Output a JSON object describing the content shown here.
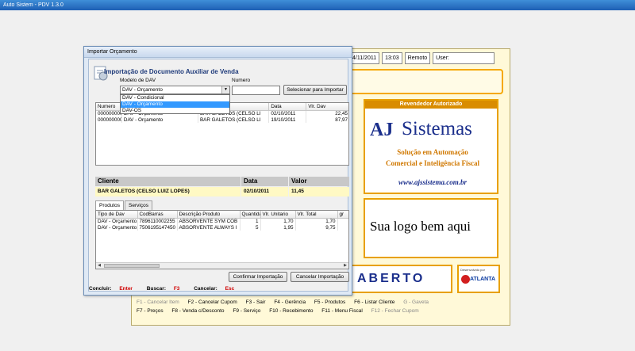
{
  "app": {
    "title": "Auto Sistem - PDV 1.3.0"
  },
  "pdv": {
    "date": "4/11/2011",
    "time": "13:03",
    "mode": "Remoto",
    "user_label": "User:",
    "reseller_header": "Revendedor Autorizado",
    "brand_a": "AJ",
    "brand_name": "Sistemas",
    "slogan_1": "Solução em Automação",
    "slogan_2": "Comercial e Inteligência Fiscal",
    "website": "www.ajssistema.com.br",
    "logo_placeholder": "Sua logo bem aqui",
    "status": "ABERTO",
    "partner_caption": "Desenvolvido por",
    "partner_name": "ATLANTA",
    "shortcuts": [
      {
        "text": "F1 - Cancelar Item",
        "dim": true
      },
      {
        "text": "F2 - Cancelar Cupom",
        "dim": false
      },
      {
        "text": "F3 - Sair",
        "dim": false
      },
      {
        "text": "F4 - Gerência",
        "dim": false
      },
      {
        "text": "F5 - Produtos",
        "dim": false
      },
      {
        "text": "F6 - Listar Cliente",
        "dim": false
      },
      {
        "text": "G - Gaveta",
        "dim": true
      },
      {
        "text": "F7 - Preços",
        "dim": false
      },
      {
        "text": "F8 - Venda c/Desconto",
        "dim": false
      },
      {
        "text": "F9 - Serviço",
        "dim": false
      },
      {
        "text": "F10 - Recebimento",
        "dim": false
      },
      {
        "text": "F11 - Menu Fiscal",
        "dim": false
      },
      {
        "text": "F12 - Fechar Cupom",
        "dim": true
      }
    ]
  },
  "dialog": {
    "title": "Importar Orçamento",
    "heading": "Importação de Documento Auxiliar de Venda",
    "model_label": "Modelo de DAV",
    "number_label": "Numero",
    "selected_model": "DAV - Orçamento",
    "model_options": [
      "DAV - Condicional",
      "DAV - Orçamento",
      "DAV-OS"
    ],
    "number_value": "",
    "select_button": "Selecionar para Importar",
    "dav_columns": [
      "Numero",
      "",
      "dio Cliente",
      "Data",
      "Vlr. Dav"
    ],
    "dav_rows": [
      [
        "0000000002",
        "DAV - Orçamento",
        "BAR GALETOS (CELSO LI",
        "02/10/2011",
        "22,45"
      ],
      [
        "0000000004",
        "DAV - Orçamento",
        "BAR GALETOS (CELSO LI",
        "19/10/2011",
        "87,97"
      ]
    ],
    "summary": {
      "client_label": "Cliente",
      "date_label": "Data",
      "value_label": "Valor",
      "client": "BAR GALETOS (CELSO LUIZ LOPES)",
      "date": "02/10/2011",
      "value": "11,45"
    },
    "tabs": [
      "Produtos",
      "Serviços"
    ],
    "item_columns": [
      "Tipo de Dav",
      "CodBarras",
      "Descrição Produto",
      "Quantida",
      "Vlr. Unitario",
      "Vlr. Total",
      "gr"
    ],
    "item_rows": [
      [
        "DAV - Orçamento",
        "7896110002255",
        "ABSORVENTE SYM COB",
        "1",
        "1,70",
        "1,70"
      ],
      [
        "DAV - Orçamento",
        "7506195147450",
        "ABSORVENTE ALWAYS I",
        "5",
        "1,95",
        "9,75"
      ]
    ],
    "confirm_button": "Confirmar Importação",
    "cancel_button": "Cancelar Importação",
    "footer": {
      "conclude_label": "Concluir:",
      "conclude_key": "Enter",
      "search_label": "Buscar:",
      "search_key": "F3",
      "cancel_label": "Cancelar:",
      "cancel_key": "Esc"
    }
  }
}
